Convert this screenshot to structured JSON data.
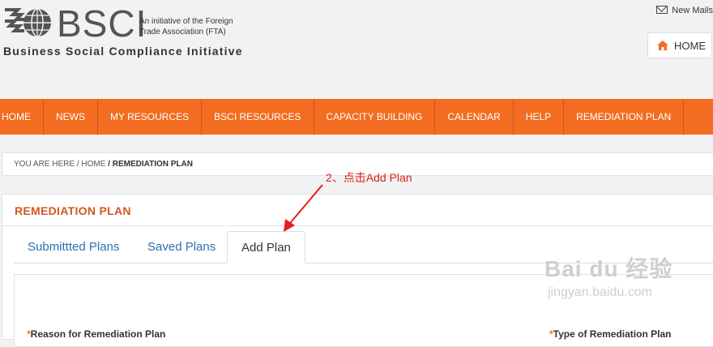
{
  "header": {
    "logo_text": "BSCI",
    "logo_sub_line1": "An initiative of the Foreign",
    "logo_sub_line2": "Trade Association (FTA)",
    "tagline": "Business Social Compliance Initiative",
    "mail_label": "New Mails",
    "home_button": "HOME"
  },
  "nav": {
    "items": [
      "HOME",
      "NEWS",
      "MY RESOURCES",
      "BSCI RESOURCES",
      "CAPACITY BUILDING",
      "CALENDAR",
      "HELP",
      "REMEDIATION PLAN"
    ]
  },
  "breadcrumb": {
    "you_are_here": "YOU ARE HERE",
    "home": "HOME",
    "current": "REMEDIATION PLAN"
  },
  "annotation": "2、点击Add Plan",
  "panel": {
    "title": "REMEDIATION PLAN",
    "tabs": [
      "Submittted Plans",
      "Saved Plans",
      "Add Plan"
    ],
    "active_tab": "Add Plan",
    "field_left": "Reason for Remediation Plan",
    "field_right": "Type of Remediation Plan"
  },
  "watermark": {
    "main": "Bai du 经验",
    "sub": "jingyan.baidu.com"
  },
  "colors": {
    "nav_bg": "#f26d21",
    "panel_title": "#d2581f",
    "tab_link": "#2f6fb4",
    "annotation": "#e02020"
  }
}
